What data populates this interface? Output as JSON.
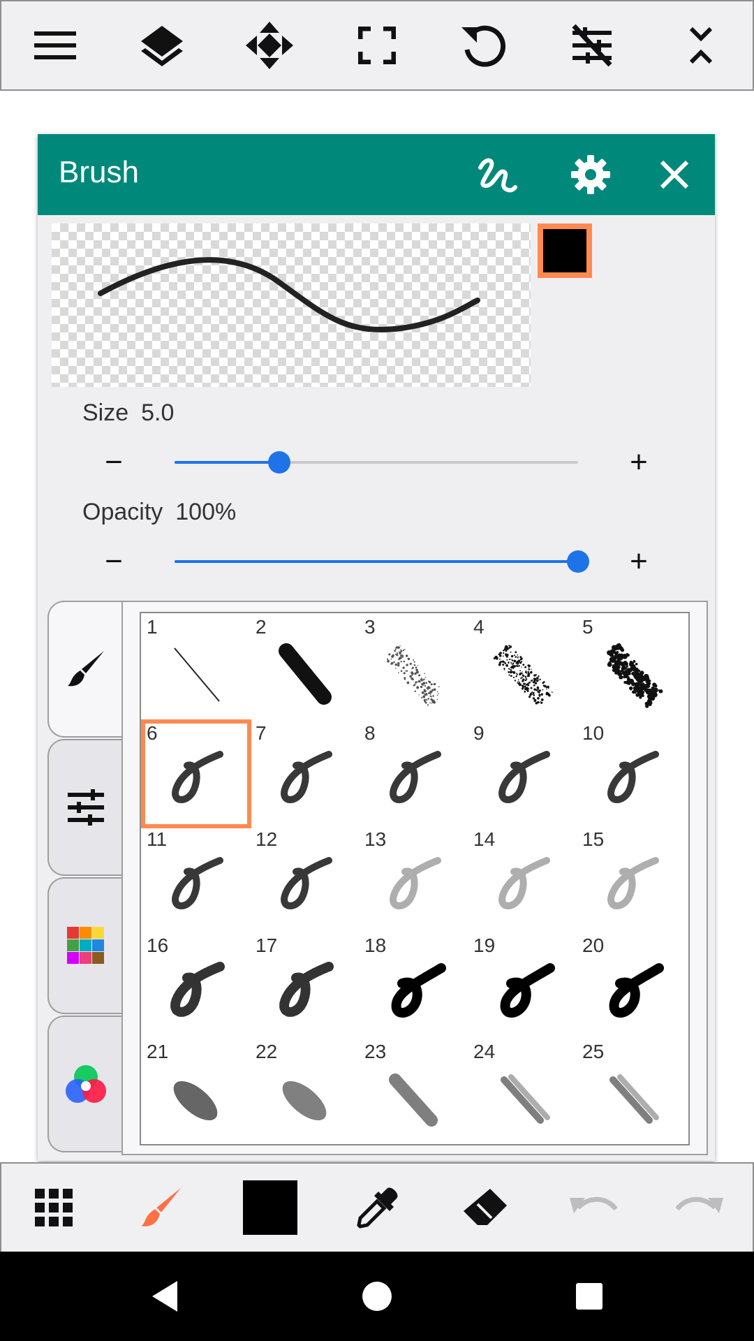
{
  "top_toolbar": {
    "icons": [
      "menu-icon",
      "layers-icon",
      "move-icon",
      "fullscreen-icon",
      "rotate-icon",
      "filter-off-icon",
      "collapse-icon"
    ]
  },
  "panel": {
    "title": "Brush",
    "header_icons": [
      "stroke-icon",
      "settings-icon",
      "close-icon"
    ],
    "color": "#000000",
    "accent": "#00897b",
    "selection_color": "#ff8a50",
    "size": {
      "label": "Size",
      "value": "5.0",
      "fraction": 0.26
    },
    "opacity": {
      "label": "Opacity",
      "value": "100%",
      "fraction": 1.0
    },
    "minus_label": "−",
    "plus_label": "+",
    "side_tabs": [
      "brush-icon",
      "adjust-icon",
      "palette-icon",
      "color-wheel-icon"
    ],
    "brushes": [
      "1",
      "2",
      "3",
      "4",
      "5",
      "6",
      "7",
      "8",
      "9",
      "10",
      "11",
      "12",
      "13",
      "14",
      "15",
      "16",
      "17",
      "18",
      "19",
      "20",
      "21",
      "22",
      "23",
      "24",
      "25"
    ],
    "selected_brush": "6"
  },
  "bottom_toolbar": {
    "icons": [
      "grid-icon",
      "brush-icon",
      "color-icon",
      "eyedropper-icon",
      "eraser-icon",
      "undo-icon",
      "redo-icon"
    ],
    "active_tool_color": "#ff7043"
  },
  "nav_bar": {
    "icons": [
      "back-icon",
      "home-icon",
      "recents-icon"
    ]
  }
}
